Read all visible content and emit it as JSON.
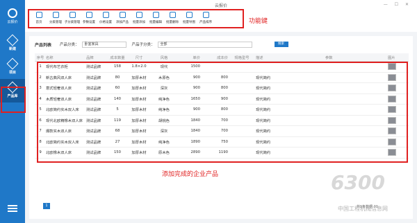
{
  "app": {
    "title": "云报价",
    "window_controls": "— ☐ ✕"
  },
  "sidebar": {
    "logo_label": "云报价",
    "items": [
      {
        "label": "新建",
        "icon": "doc-icon",
        "active": false
      },
      {
        "label": "项目",
        "icon": "cube-icon",
        "active": false
      },
      {
        "label": "产品库",
        "icon": "library-icon",
        "active": true
      }
    ],
    "menu_icon": "hamburger-icon"
  },
  "toolbar": {
    "buttons": [
      {
        "label": "首页",
        "icon": "home-icon"
      },
      {
        "label": "分类管理",
        "icon": "grid-icon"
      },
      {
        "label": "子分类管理",
        "icon": "list-icon"
      },
      {
        "label": "参数设置",
        "icon": "gear-icon"
      },
      {
        "label": "价格设置",
        "icon": "price-icon"
      },
      {
        "label": "添加产品",
        "icon": "plus-icon"
      },
      {
        "label": "批量添加",
        "icon": "batch-add-icon"
      },
      {
        "label": "批量编辑",
        "icon": "edit-icon"
      },
      {
        "label": "批量删除",
        "icon": "delete-icon"
      },
      {
        "label": "批量导图",
        "icon": "image-icon"
      },
      {
        "label": "产品排序",
        "icon": "sort-icon"
      }
    ]
  },
  "annotations": {
    "function_keys": "功能键",
    "added_products": "添加完成的企业产品"
  },
  "filter": {
    "title": "产品列表",
    "category_label": "产品分类：",
    "category_value": "卧室家具",
    "subcategory_label": "产品子分类：",
    "subcategory_value": "全部",
    "search_button": "搜索"
  },
  "table": {
    "headers": [
      "序号",
      "名称",
      "品牌",
      "成本数量",
      "尺寸",
      "风格",
      "单价",
      "成本价",
      "规格型号",
      "描述",
      "参数",
      "图片"
    ],
    "rows": [
      [
        "1",
        "现代布艺衣柜",
        "测试品牌",
        "158",
        "1.8×2.0",
        "现代",
        "1500",
        "",
        "",
        "",
        "",
        ""
      ],
      [
        "2",
        "新古典风双人床",
        "测试品牌",
        "80",
        "加厚木材",
        "木原色",
        "900",
        "800",
        "",
        "现代简约",
        "",
        ""
      ],
      [
        "3",
        "意式轻奢双人床",
        "测试品牌",
        "60",
        "加厚木材",
        "深灰",
        "900",
        "800",
        "",
        "现代简约",
        "",
        ""
      ],
      [
        "4",
        "木质轻奢双人床",
        "测试品牌",
        "140",
        "加厚木材",
        "纯净色",
        "1650",
        "900",
        "",
        "现代简约",
        "",
        ""
      ],
      [
        "5",
        "北欧简约实木双人床",
        "测试品牌",
        "5",
        "加厚木材",
        "纯净色",
        "900",
        "800",
        "",
        "现代简约",
        "",
        ""
      ],
      [
        "6",
        "现代北欧精橡木双人床",
        "测试品牌",
        "119",
        "加厚木材",
        "胡桃色",
        "1840",
        "700",
        "",
        "现代简约",
        "",
        ""
      ],
      [
        "7",
        "爆款实木双人床",
        "测试品牌",
        "68",
        "加厚木材",
        "深灰",
        "1840",
        "700",
        "",
        "现代简约",
        "",
        ""
      ],
      [
        "8",
        "北欧简约实木双人床",
        "测试品牌",
        "27",
        "加厚木材",
        "纯净色",
        "1890",
        "750",
        "",
        "现代简约",
        "",
        ""
      ],
      [
        "9",
        "北欧橡木双人床",
        "测试品牌",
        "150",
        "加厚木材",
        "原木色",
        "2890",
        "1190",
        "",
        "现代简约",
        "",
        ""
      ]
    ],
    "thumb_rows": [
      true,
      true,
      true,
      true,
      true,
      true,
      true,
      true,
      true
    ]
  },
  "pagination": {
    "current_page": "1",
    "total_text": "共9条数据 20"
  },
  "watermark": {
    "number": "6300",
    "text": "中国工程机械信息网"
  }
}
